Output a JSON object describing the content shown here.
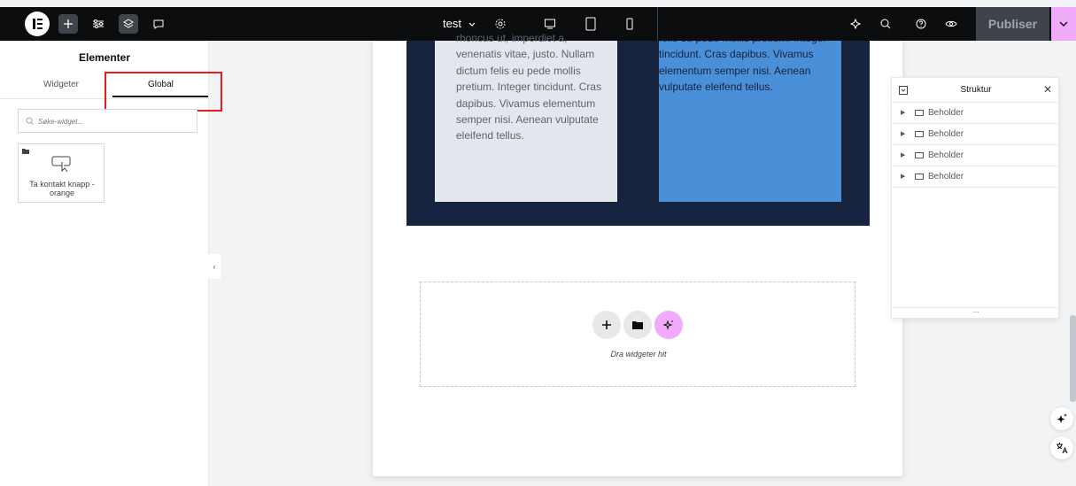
{
  "topbar": {
    "doc_title": "test",
    "publish_label": "Publiser",
    "icons": [
      "elementor-logo-icon",
      "plus-icon",
      "sliders-icon",
      "layers-icon",
      "comment-icon",
      "chevron-down-icon",
      "gear-icon",
      "desktop-icon",
      "tablet-icon",
      "mobile-icon",
      "ai-sparkle-icon",
      "search-icon",
      "help-icon",
      "eye-icon"
    ]
  },
  "left_panel": {
    "title": "Elementer",
    "tabs": [
      {
        "label": "Widgeter",
        "active": false
      },
      {
        "label": "Global",
        "active": true
      }
    ],
    "search_placeholder": "Søke-widget...",
    "widgets": [
      {
        "label": "Ta kontakt knapp - orange",
        "icon": "button-cursor-icon"
      }
    ]
  },
  "canvas": {
    "col1_text": "rhoncus ut, imperdiet a, venenatis vitae, justo. Nullam dictum felis eu pede mollis pretium. Integer tincidunt. Cras dapibus. Vivamus elementum semper nisi. Aenean vulputate eleifend tellus.",
    "col2_text": "felis eu pede mollis pretium. Integer tincidunt. Cras dapibus. Vivamus elementum semper nisi. Aenean vulputate eleifend tellus.",
    "drop_zone_label": "Dra widgeter hit"
  },
  "structure": {
    "title": "Struktur",
    "items": [
      "Beholder",
      "Beholder",
      "Beholder",
      "Beholder"
    ],
    "footer": "..."
  },
  "colors": {
    "topbar_bg": "#0c0d0e",
    "accent_pink": "#f0abfc",
    "dark_section": "#15233f",
    "blue_column": "#4a90d9",
    "highlight_red": "#e41d1d"
  }
}
